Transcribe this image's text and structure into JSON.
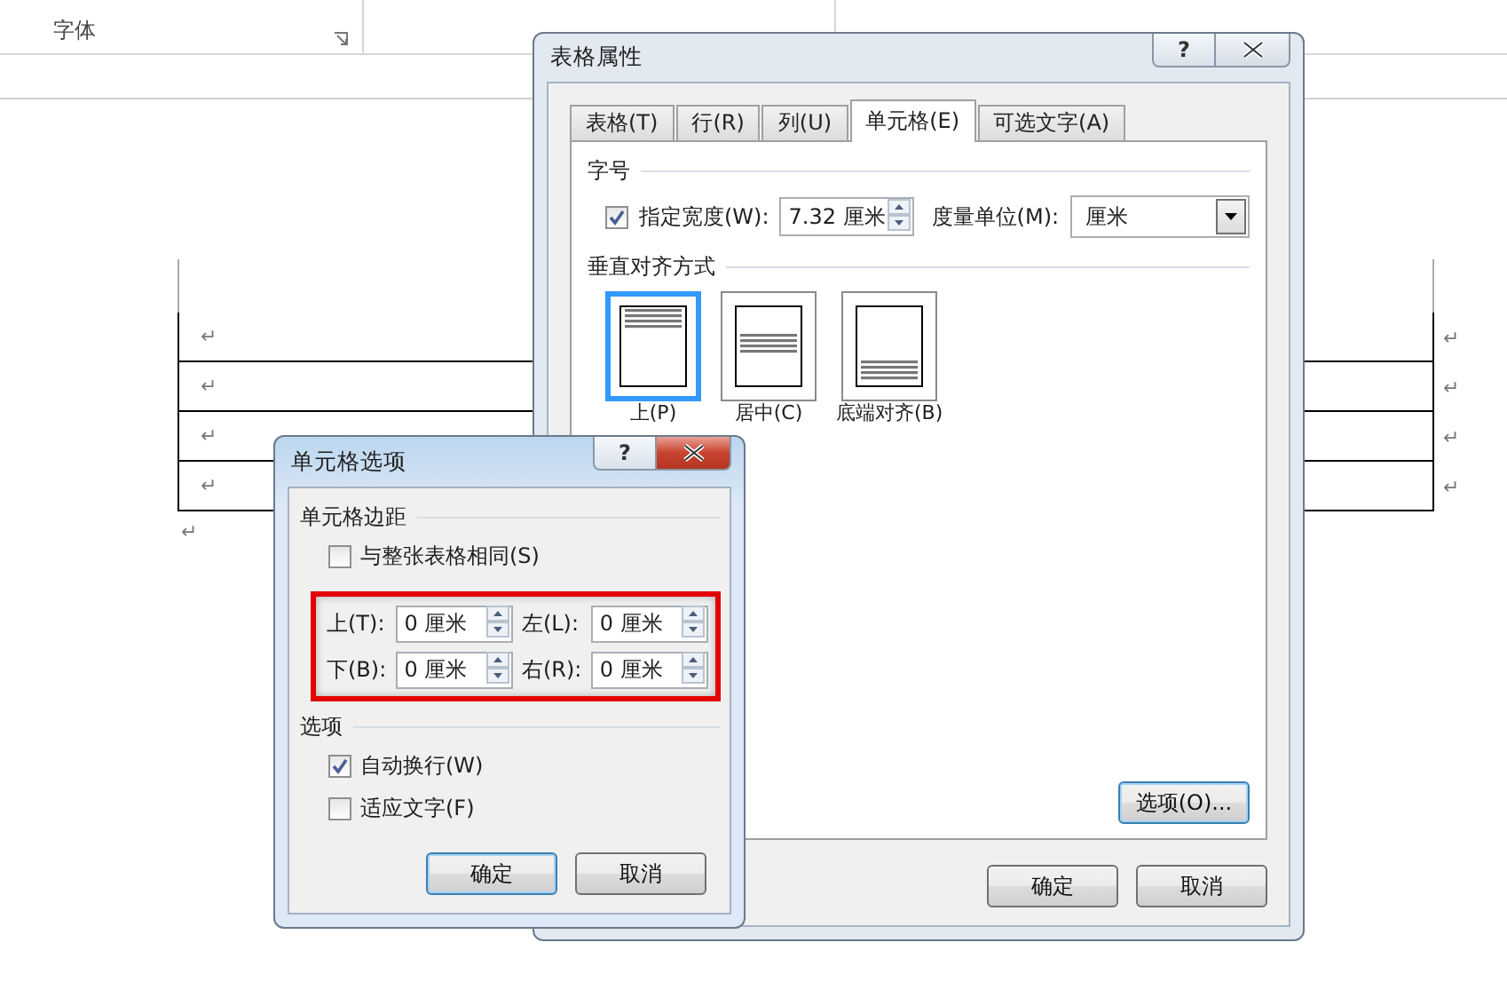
{
  "ribbon": {
    "groups": [
      {
        "label": "字体"
      }
    ]
  },
  "document": {
    "rows": [
      {
        "mark": "↵",
        "end_mark": "↵"
      },
      {
        "mark": "↵",
        "end_mark": "↵"
      },
      {
        "mark": "↵",
        "end_mark": "↵"
      },
      {
        "mark": "↵",
        "end_mark": "↵"
      }
    ],
    "after_mark": "↵"
  },
  "table_properties_dialog": {
    "title": "表格属性",
    "help": "?",
    "tabs": [
      {
        "label": "表格(T)",
        "selected": false
      },
      {
        "label": "行(R)",
        "selected": false
      },
      {
        "label": "列(U)",
        "selected": false
      },
      {
        "label": "单元格(E)",
        "selected": true
      },
      {
        "label": "可选文字(A)",
        "selected": false
      }
    ],
    "size_section": {
      "title": "字号",
      "specify_width": {
        "label": "指定宽度(W):",
        "checked": true
      },
      "width_value": "7.32 厘米",
      "unit_label": "度量单位(M):",
      "unit_value": "厘米"
    },
    "vertical_alignment": {
      "title": "垂直对齐方式",
      "options": [
        {
          "label": "上(P)",
          "kind": "top",
          "selected": true
        },
        {
          "label": "居中(C)",
          "kind": "center",
          "selected": false
        },
        {
          "label": "底端对齐(B)",
          "kind": "bottom",
          "selected": false
        }
      ]
    },
    "options_button": "选项(O)...",
    "buttons": [
      "确定",
      "取消"
    ]
  },
  "cell_options_dialog": {
    "title": "单元格选项",
    "help": "?",
    "margins_section": {
      "title": "单元格边距",
      "same_as_table": {
        "label": "与整张表格相同(S)",
        "checked": false
      },
      "fields": [
        {
          "label": "上(T):",
          "value": "0 厘米"
        },
        {
          "label": "左(L):",
          "value": "0 厘米"
        },
        {
          "label": "下(B):",
          "value": "0 厘米"
        },
        {
          "label": "右(R):",
          "value": "0 厘米"
        }
      ]
    },
    "options_section": {
      "title": "选项",
      "checkboxes": [
        {
          "label": "自动换行(W)",
          "checked": true
        },
        {
          "label": "适应文字(F)",
          "checked": false
        }
      ]
    },
    "buttons": [
      "确定",
      "取消"
    ]
  }
}
